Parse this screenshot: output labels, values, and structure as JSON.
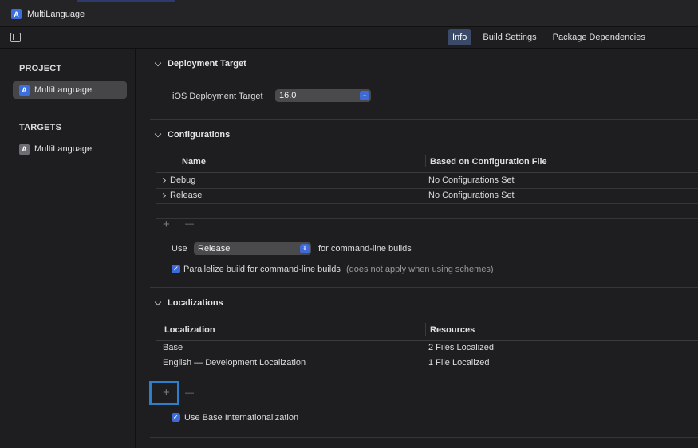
{
  "app": {
    "file_tab_label": "MultiLanguage",
    "file_tab_icon": "xcode-app-icon"
  },
  "editor_tabs": [
    {
      "label": "Info",
      "active": true
    },
    {
      "label": "Build Settings",
      "active": false
    },
    {
      "label": "Package Dependencies",
      "active": false
    }
  ],
  "sidebar": {
    "project_header": "PROJECT",
    "project_item": "MultiLanguage",
    "targets_header": "TARGETS",
    "target_item": "MultiLanguage"
  },
  "deployment": {
    "title": "Deployment Target",
    "label": "iOS Deployment Target",
    "value": "16.0"
  },
  "configurations": {
    "title": "Configurations",
    "headers": {
      "name": "Name",
      "based_on": "Based on Configuration File"
    },
    "rows": [
      {
        "name": "Debug",
        "based_on": "No Configurations Set"
      },
      {
        "name": "Release",
        "based_on": "No Configurations Set"
      }
    ],
    "add_symbol": "+",
    "remove_symbol": "—",
    "use_label": "Use",
    "use_value": "Release",
    "use_suffix": "for command-line builds",
    "parallelize_label": "Parallelize build for command-line builds",
    "parallelize_hint": "(does not apply when using schemes)",
    "parallelize_checked": true
  },
  "localizations": {
    "title": "Localizations",
    "headers": {
      "localization": "Localization",
      "resources": "Resources"
    },
    "rows": [
      {
        "localization": "Base",
        "resources": "2 Files Localized"
      },
      {
        "localization": "English — Development Localization",
        "resources": "1 File Localized"
      }
    ],
    "add_symbol": "+",
    "remove_symbol": "—",
    "base_intl_label": "Use Base Internationalization",
    "base_intl_checked": true
  },
  "colors": {
    "accent": "#3f6ad8",
    "highlight": "#2f7ec9"
  }
}
